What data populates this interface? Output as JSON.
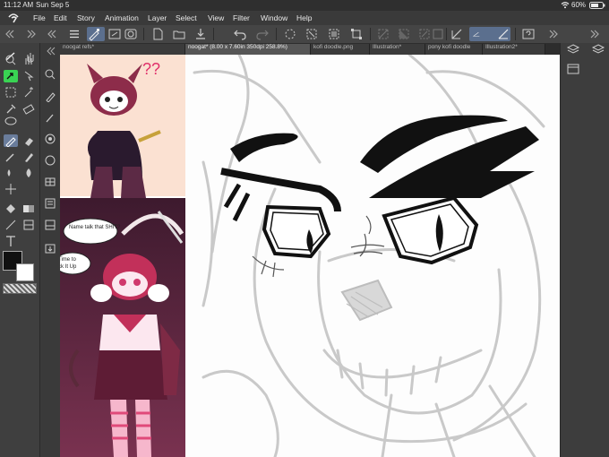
{
  "status_bar": {
    "time": "11:12 AM",
    "date": "Sun Sep 5",
    "battery": "60%"
  },
  "menu": {
    "items": [
      "File",
      "Edit",
      "Story",
      "Animation",
      "Layer",
      "Select",
      "View",
      "Filter",
      "Window",
      "Help"
    ]
  },
  "tabs": [
    {
      "label": "noogat refs*"
    },
    {
      "label": "noogat* (8.00 x 7.60in 350dpi 258.8%)"
    },
    {
      "label": "kofi doodle.png"
    },
    {
      "label": "Illustration*"
    },
    {
      "label": "pony kofi doodle"
    },
    {
      "label": "Illustration2*"
    }
  ],
  "reference": {
    "speech_bubble": "Name talk that SHIT?",
    "speech_bubble_2": "Time to\nck It Up",
    "question_marks": "??"
  },
  "colors": {
    "accent": "#6a7d9c",
    "main_color": "#111111",
    "sub_color": "#ffffff",
    "active_fill_tool": "#39d353"
  },
  "icons": {
    "command_bar": [
      "menu-icon",
      "tool-property-icon",
      "brush-size-icon",
      "new-icon",
      "open-icon",
      "save-icon",
      "undo-icon",
      "redo-icon",
      "loading-icon",
      "clear-icon",
      "fill-icon",
      "transform-icon",
      "deselect-icon",
      "invert-icon",
      "crop-icon",
      "show-area-icon",
      "hide-selection-icon",
      "ruler-snap-icon",
      "special-ruler-icon",
      "grid-icon",
      "help-icon"
    ],
    "right_panel": [
      "layers-icon",
      "layer-property-icon",
      "navigator-icon"
    ]
  }
}
